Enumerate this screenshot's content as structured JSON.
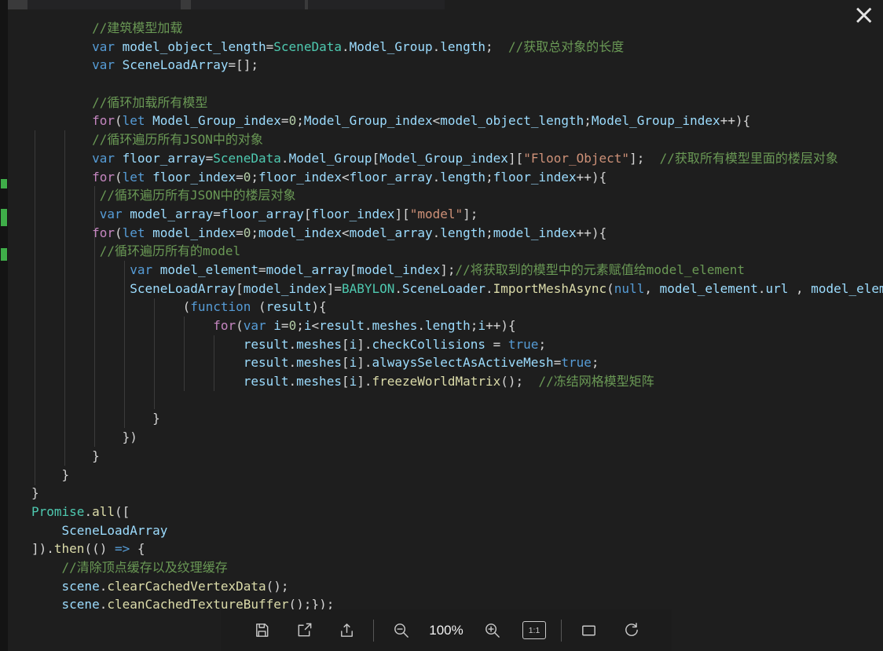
{
  "window": {
    "close_label": "×"
  },
  "background": {
    "brace": "}"
  },
  "toolbar": {
    "zoom_level": "100%",
    "actual_size_label": "1:1"
  },
  "colors": {
    "bg": "#1e1e1e",
    "toolbar-bg": "#1c1c1c",
    "mark": "#3fae49",
    "syntax": {
      "cm": "#6A9955",
      "kw": "#569CD6",
      "ctl": "#C586C0",
      "id": "#9CDCFE",
      "cls": "#4EC9B0",
      "fn": "#DCDCAA",
      "str": "#CE9178",
      "num": "#B5CEA8",
      "pn": "#D4D4D4"
    }
  },
  "code": {
    "language": "javascript",
    "lines": [
      [
        [
          "cm",
          "        //建筑模型加载"
        ]
      ],
      [
        [
          "pn",
          "        "
        ],
        [
          "kw",
          "var"
        ],
        [
          "pn",
          " "
        ],
        [
          "id",
          "model_object_length"
        ],
        [
          "pn",
          "="
        ],
        [
          "cls",
          "SceneData"
        ],
        [
          "pn",
          "."
        ],
        [
          "id",
          "Model_Group"
        ],
        [
          "pn",
          "."
        ],
        [
          "id",
          "length"
        ],
        [
          "pn",
          ";  "
        ],
        [
          "cm",
          "//获取总对象的长度"
        ]
      ],
      [
        [
          "pn",
          "        "
        ],
        [
          "kw",
          "var"
        ],
        [
          "pn",
          " "
        ],
        [
          "id",
          "SceneLoadArray"
        ],
        [
          "pn",
          "=[];"
        ]
      ],
      [],
      [
        [
          "cm",
          "        //循环加载所有模型"
        ]
      ],
      [
        [
          "pn",
          "        "
        ],
        [
          "ctl",
          "for"
        ],
        [
          "pn",
          "("
        ],
        [
          "kw",
          "let"
        ],
        [
          "pn",
          " "
        ],
        [
          "id",
          "Model_Group_index"
        ],
        [
          "pn",
          "="
        ],
        [
          "num",
          "0"
        ],
        [
          "pn",
          ";"
        ],
        [
          "id",
          "Model_Group_index"
        ],
        [
          "pn",
          "<"
        ],
        [
          "id",
          "model_object_length"
        ],
        [
          "pn",
          ";"
        ],
        [
          "id",
          "Model_Group_index"
        ],
        [
          "pn",
          "++){"
        ]
      ],
      [
        [
          "cm",
          "        //循环遍历所有JSON中的对象"
        ]
      ],
      [
        [
          "pn",
          "        "
        ],
        [
          "kw",
          "var"
        ],
        [
          "pn",
          " "
        ],
        [
          "id",
          "floor_array"
        ],
        [
          "pn",
          "="
        ],
        [
          "cls",
          "SceneData"
        ],
        [
          "pn",
          "."
        ],
        [
          "id",
          "Model_Group"
        ],
        [
          "pn",
          "["
        ],
        [
          "id",
          "Model_Group_index"
        ],
        [
          "pn",
          "]["
        ],
        [
          "str",
          "\"Floor_Object\""
        ],
        [
          "pn",
          "];  "
        ],
        [
          "cm",
          "//获取所有模型里面的楼层对象"
        ]
      ],
      [
        [
          "pn",
          "        "
        ],
        [
          "ctl",
          "for"
        ],
        [
          "pn",
          "("
        ],
        [
          "kw",
          "let"
        ],
        [
          "pn",
          " "
        ],
        [
          "id",
          "floor_index"
        ],
        [
          "pn",
          "="
        ],
        [
          "num",
          "0"
        ],
        [
          "pn",
          ";"
        ],
        [
          "id",
          "floor_index"
        ],
        [
          "pn",
          "<"
        ],
        [
          "id",
          "floor_array"
        ],
        [
          "pn",
          "."
        ],
        [
          "id",
          "length"
        ],
        [
          "pn",
          ";"
        ],
        [
          "id",
          "floor_index"
        ],
        [
          "pn",
          "++){"
        ]
      ],
      [
        [
          "cm",
          "         //循环遍历所有JSON中的楼层对象"
        ]
      ],
      [
        [
          "pn",
          "         "
        ],
        [
          "kw",
          "var"
        ],
        [
          "pn",
          " "
        ],
        [
          "id",
          "model_array"
        ],
        [
          "pn",
          "="
        ],
        [
          "id",
          "floor_array"
        ],
        [
          "pn",
          "["
        ],
        [
          "id",
          "floor_index"
        ],
        [
          "pn",
          "]["
        ],
        [
          "str",
          "\"model\""
        ],
        [
          "pn",
          "];"
        ]
      ],
      [
        [
          "pn",
          "        "
        ],
        [
          "ctl",
          "for"
        ],
        [
          "pn",
          "("
        ],
        [
          "kw",
          "let"
        ],
        [
          "pn",
          " "
        ],
        [
          "id",
          "model_index"
        ],
        [
          "pn",
          "="
        ],
        [
          "num",
          "0"
        ],
        [
          "pn",
          ";"
        ],
        [
          "id",
          "model_index"
        ],
        [
          "pn",
          "<"
        ],
        [
          "id",
          "model_array"
        ],
        [
          "pn",
          "."
        ],
        [
          "id",
          "length"
        ],
        [
          "pn",
          ";"
        ],
        [
          "id",
          "model_index"
        ],
        [
          "pn",
          "++){"
        ]
      ],
      [
        [
          "cm",
          "         //循环遍历所有的model"
        ]
      ],
      [
        [
          "pn",
          "             "
        ],
        [
          "kw",
          "var"
        ],
        [
          "pn",
          " "
        ],
        [
          "id",
          "model_element"
        ],
        [
          "pn",
          "="
        ],
        [
          "id",
          "model_array"
        ],
        [
          "pn",
          "["
        ],
        [
          "id",
          "model_index"
        ],
        [
          "pn",
          "];"
        ],
        [
          "cm",
          "//将获取到的模型中的元素赋值给model_element"
        ]
      ],
      [
        [
          "pn",
          "             "
        ],
        [
          "id",
          "SceneLoadArray"
        ],
        [
          "pn",
          "["
        ],
        [
          "id",
          "model_index"
        ],
        [
          "pn",
          "]="
        ],
        [
          "cls",
          "BABYLON"
        ],
        [
          "pn",
          "."
        ],
        [
          "id",
          "SceneLoader"
        ],
        [
          "pn",
          "."
        ],
        [
          "fn",
          "ImportMeshAsync"
        ],
        [
          "pn",
          "("
        ],
        [
          "kw",
          "null"
        ],
        [
          "pn",
          ", "
        ],
        [
          "id",
          "model_element"
        ],
        [
          "pn",
          "."
        ],
        [
          "id",
          "url"
        ],
        [
          "pn",
          " , "
        ],
        [
          "id",
          "model_element"
        ]
      ],
      [
        [
          "pn",
          "                    ("
        ],
        [
          "kw",
          "function"
        ],
        [
          "pn",
          " ("
        ],
        [
          "id",
          "result"
        ],
        [
          "pn",
          "){"
        ]
      ],
      [
        [
          "pn",
          "                        "
        ],
        [
          "ctl",
          "for"
        ],
        [
          "pn",
          "("
        ],
        [
          "kw",
          "var"
        ],
        [
          "pn",
          " "
        ],
        [
          "id",
          "i"
        ],
        [
          "pn",
          "="
        ],
        [
          "num",
          "0"
        ],
        [
          "pn",
          ";"
        ],
        [
          "id",
          "i"
        ],
        [
          "pn",
          "<"
        ],
        [
          "id",
          "result"
        ],
        [
          "pn",
          "."
        ],
        [
          "id",
          "meshes"
        ],
        [
          "pn",
          "."
        ],
        [
          "id",
          "length"
        ],
        [
          "pn",
          ";"
        ],
        [
          "id",
          "i"
        ],
        [
          "pn",
          "++){"
        ]
      ],
      [
        [
          "pn",
          "                            "
        ],
        [
          "id",
          "result"
        ],
        [
          "pn",
          "."
        ],
        [
          "id",
          "meshes"
        ],
        [
          "pn",
          "["
        ],
        [
          "id",
          "i"
        ],
        [
          "pn",
          "]."
        ],
        [
          "id",
          "checkCollisions"
        ],
        [
          "pn",
          " = "
        ],
        [
          "kw",
          "true"
        ],
        [
          "pn",
          ";"
        ]
      ],
      [
        [
          "pn",
          "                            "
        ],
        [
          "id",
          "result"
        ],
        [
          "pn",
          "."
        ],
        [
          "id",
          "meshes"
        ],
        [
          "pn",
          "["
        ],
        [
          "id",
          "i"
        ],
        [
          "pn",
          "]."
        ],
        [
          "id",
          "alwaysSelectAsActiveMesh"
        ],
        [
          "pn",
          "="
        ],
        [
          "kw",
          "true"
        ],
        [
          "pn",
          ";"
        ]
      ],
      [
        [
          "pn",
          "                            "
        ],
        [
          "id",
          "result"
        ],
        [
          "pn",
          "."
        ],
        [
          "id",
          "meshes"
        ],
        [
          "pn",
          "["
        ],
        [
          "id",
          "i"
        ],
        [
          "pn",
          "]."
        ],
        [
          "fn",
          "freezeWorldMatrix"
        ],
        [
          "pn",
          "();  "
        ],
        [
          "cm",
          "//冻结网格模型矩阵"
        ]
      ],
      [],
      [
        [
          "pn",
          "                }"
        ]
      ],
      [
        [
          "pn",
          "            })"
        ]
      ],
      [
        [
          "pn",
          "        }"
        ]
      ],
      [
        [
          "pn",
          "    }"
        ]
      ],
      [
        [
          "pn",
          "}"
        ]
      ],
      [
        [
          "cls",
          "Promise"
        ],
        [
          "pn",
          "."
        ],
        [
          "fn",
          "all"
        ],
        [
          "pn",
          "(["
        ]
      ],
      [
        [
          "pn",
          "    "
        ],
        [
          "id",
          "SceneLoadArray"
        ]
      ],
      [
        [
          "pn",
          "])."
        ],
        [
          "fn",
          "then"
        ],
        [
          "pn",
          "(() "
        ],
        [
          "kw",
          "=>"
        ],
        [
          "pn",
          " {"
        ]
      ],
      [
        [
          "cm",
          "    //清除顶点缓存以及纹理缓存"
        ]
      ],
      [
        [
          "pn",
          "    "
        ],
        [
          "id",
          "scene"
        ],
        [
          "pn",
          "."
        ],
        [
          "fn",
          "clearCachedVertexData"
        ],
        [
          "pn",
          "();"
        ]
      ],
      [
        [
          "pn",
          "    "
        ],
        [
          "id",
          "scene"
        ],
        [
          "pn",
          "."
        ],
        [
          "fn",
          "cleanCachedTextureBuffer"
        ],
        [
          "pn",
          "();});"
        ]
      ]
    ]
  }
}
